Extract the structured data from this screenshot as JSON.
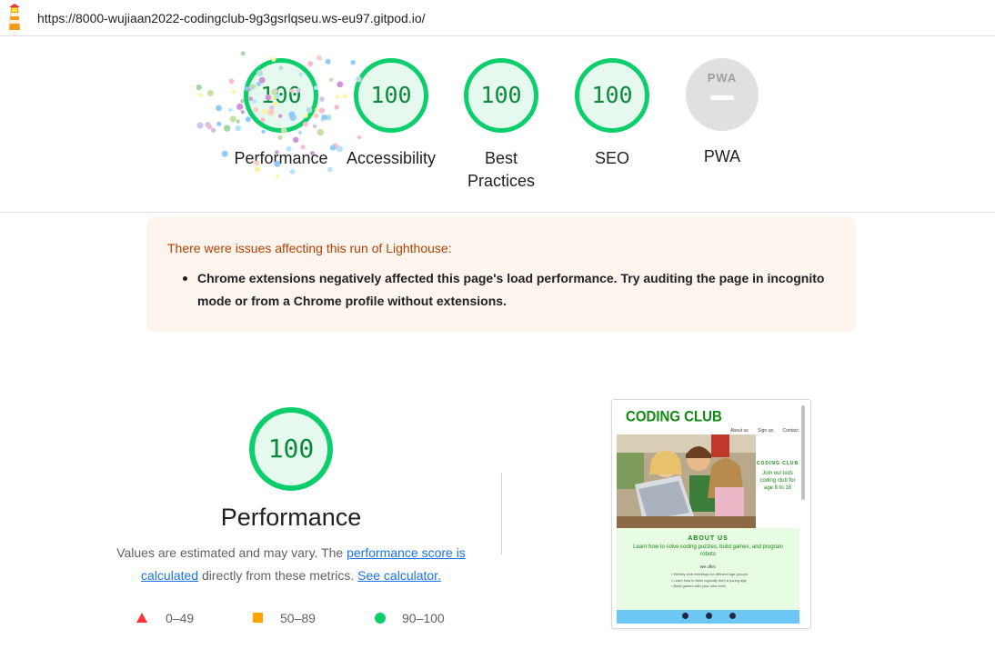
{
  "browser": {
    "url": "https://8000-wujiaan2022-codingclub-9g3gsrlqseu.ws-eu97.gitpod.io/",
    "logo_icon": "lighthouse-icon"
  },
  "gauges": [
    {
      "score": "100",
      "label": "Performance"
    },
    {
      "score": "100",
      "label": "Accessibility"
    },
    {
      "score": "100",
      "label": "Best Practices"
    },
    {
      "score": "100",
      "label": "SEO"
    },
    {
      "score": "",
      "label": "PWA",
      "badge": "PWA"
    }
  ],
  "warning": {
    "title": "There were issues affecting this run of Lighthouse:",
    "items": [
      "Chrome extensions negatively affected this page's load performance. Try auditing the page in incognito mode or from a Chrome profile without extensions."
    ]
  },
  "performance": {
    "score": "100",
    "title": "Performance",
    "desc_prefix": "Values are estimated and may vary. The ",
    "link_score": "performance score is calculated",
    "desc_middle": " directly from these metrics. ",
    "link_calculator": "See calculator.",
    "legend": [
      {
        "icon": "fail-triangle-icon",
        "range": "0–49",
        "color": "#ff3333"
      },
      {
        "icon": "average-square-icon",
        "range": "50–89",
        "color": "#ffa400"
      },
      {
        "icon": "pass-circle-icon",
        "range": "90–100",
        "color": "#0cce6b"
      }
    ]
  },
  "screenshot": {
    "title": "CODING CLUB",
    "nav": [
      "About us",
      "Sign up",
      "Contact"
    ],
    "side_title": "CODING CLUB",
    "side_text": "Join our kids coding club for age 8 to 18",
    "about_title": "ABOUT US",
    "about_text": "Learn how to solve coding puzzles, build games, and program robots",
    "offer_title": "We offer:",
    "offer_items": [
      "• Weekly club meetings for different age groups",
      "• Learn how to think logically from a young age",
      "• Build games with your own code"
    ]
  },
  "colors": {
    "pass": "#0cce6b",
    "warning_text": "#b24200",
    "link": "#1a73e8"
  }
}
